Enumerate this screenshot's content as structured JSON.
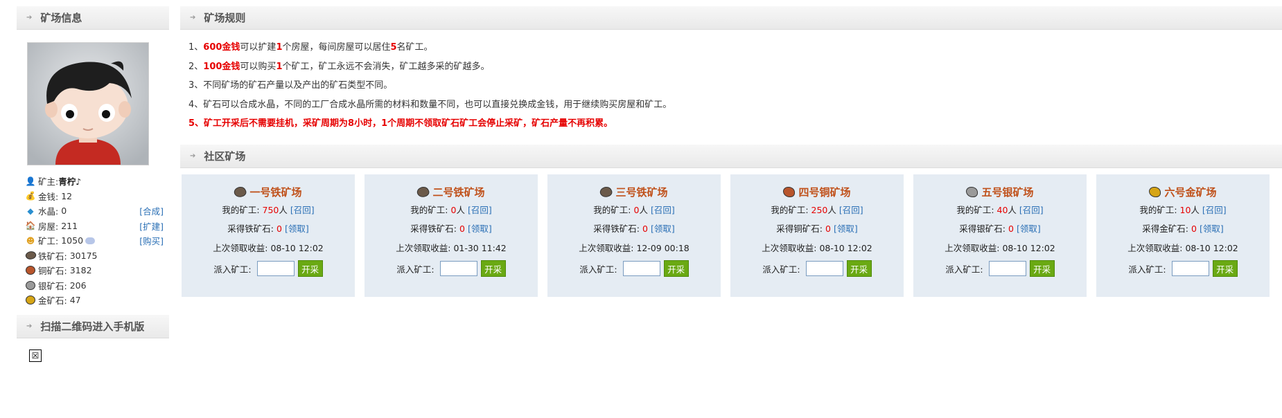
{
  "sidebar": {
    "mine_info_title": "矿场信息",
    "qr_title": "扫描二维码进入手机版",
    "qr_placeholder": "☒",
    "stats": {
      "owner_label": "矿主:",
      "owner_name": "青柠♪",
      "gold_label": "金钱:",
      "gold_value": "12",
      "crystal_label": "水晶:",
      "crystal_value": "0",
      "crystal_action": "[合成]",
      "house_label": "房屋:",
      "house_value": "211",
      "house_action": "[扩建]",
      "miner_label": "矿工:",
      "miner_value": "1050",
      "miner_action": "[购买]",
      "iron_label": "铁矿石:",
      "iron_value": "30175",
      "copper_label": "铜矿石:",
      "copper_value": "3182",
      "silver_label": "银矿石:",
      "silver_value": "206",
      "goldore_label": "金矿石:",
      "goldore_value": "47"
    }
  },
  "rules": {
    "title": "矿场规则",
    "r1": {
      "prefix": "1、",
      "amount": "600金钱",
      "mid1": "可以扩建",
      "count": "1",
      "mid2": "个房屋，每间房屋可以居住",
      "count2": "5",
      "end": "名矿工。"
    },
    "r2": {
      "prefix": "2、",
      "amount": "100金钱",
      "mid1": "可以购买",
      "count": "1",
      "end": "个矿工，矿工永远不会消失，矿工越多采的矿越多。"
    },
    "r3": "3、不同矿场的矿石产量以及产出的矿石类型不同。",
    "r4": "4、矿石可以合成水晶，不同的工厂合成水晶所需的材料和数量不同，也可以直接兑换成金钱，用于继续购买房屋和矿工。",
    "r5": "5、矿工开采后不需要挂机，采矿周期为8小时，1个周期不领取矿石矿工会停止采矿，矿石产量不再积累。"
  },
  "community": {
    "title": "社区矿场",
    "labels": {
      "my_miners": "我的矿工:",
      "people": "人",
      "recall": "[召回]",
      "claim": "[领取]",
      "last_claim": "上次领取收益:",
      "dispatch": "派入矿工:",
      "start_button": "开采"
    },
    "mines": [
      {
        "name": "一号铁矿场",
        "ore_color": "#6b5a4a",
        "miners": "750",
        "collected_label": "采得铁矿石:",
        "collected": "0",
        "last_time": "08-10 12:02"
      },
      {
        "name": "二号铁矿场",
        "ore_color": "#6b5a4a",
        "miners": "0",
        "collected_label": "采得铁矿石:",
        "collected": "0",
        "last_time": "01-30 11:42"
      },
      {
        "name": "三号铁矿场",
        "ore_color": "#6b5a4a",
        "miners": "0",
        "collected_label": "采得铁矿石:",
        "collected": "0",
        "last_time": "12-09 00:18"
      },
      {
        "name": "四号铜矿场",
        "ore_color": "#b8552c",
        "miners": "250",
        "collected_label": "采得铜矿石:",
        "collected": "0",
        "last_time": "08-10 12:02"
      },
      {
        "name": "五号银矿场",
        "ore_color": "#9a9a9a",
        "miners": "40",
        "collected_label": "采得银矿石:",
        "collected": "0",
        "last_time": "08-10 12:02"
      },
      {
        "name": "六号金矿场",
        "ore_color": "#d6a516",
        "miners": "10",
        "collected_label": "采得金矿石:",
        "collected": "0",
        "last_time": "08-10 12:02"
      }
    ]
  }
}
